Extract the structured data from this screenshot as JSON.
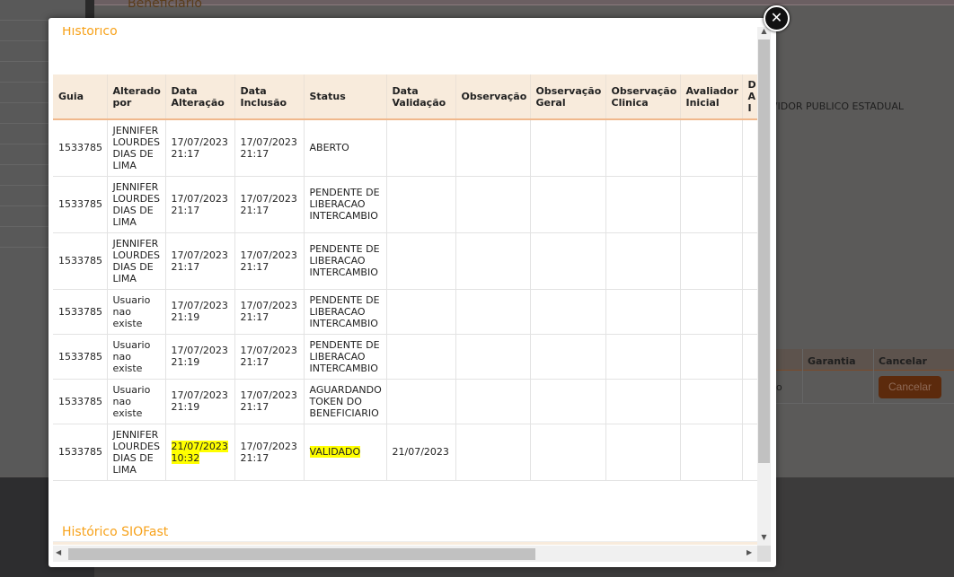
{
  "background": {
    "section_title": "Beneficiario",
    "partial_text": "VIDOR PUBLICO ESTADUAL",
    "table_headers": [
      "Garantia",
      "Cancelar"
    ],
    "partial_cell": "o",
    "cancel_button": "Cancelar"
  },
  "modal": {
    "close_icon": "close-x-icon",
    "title": "Histórico",
    "columns": [
      "Guia",
      "Alterado por",
      "Data Alteração",
      "Data Inclusão",
      "Status",
      "Data Validação",
      "Observação",
      "Observação Geral",
      "Observação Clinica",
      "Avaliador Inicial",
      "D A I"
    ],
    "rows": [
      {
        "guia": "1533785",
        "alterado_por": "JENNIFER LOURDES DIAS DE LIMA",
        "data_alteracao": "17/07/2023 21:17",
        "data_inclusao": "17/07/2023 21:17",
        "status": "ABERTO",
        "data_validacao": ""
      },
      {
        "guia": "1533785",
        "alterado_por": "JENNIFER LOURDES DIAS DE LIMA",
        "data_alteracao": "17/07/2023 21:17",
        "data_inclusao": "17/07/2023 21:17",
        "status": "PENDENTE DE LIBERACAO INTERCAMBIO",
        "data_validacao": ""
      },
      {
        "guia": "1533785",
        "alterado_por": "JENNIFER LOURDES DIAS DE LIMA",
        "data_alteracao": "17/07/2023 21:17",
        "data_inclusao": "17/07/2023 21:17",
        "status": "PENDENTE DE LIBERACAO INTERCAMBIO",
        "data_validacao": ""
      },
      {
        "guia": "1533785",
        "alterado_por": "Usuario nao existe",
        "data_alteracao": "17/07/2023 21:19",
        "data_inclusao": "17/07/2023 21:17",
        "status": "PENDENTE DE LIBERACAO INTERCAMBIO",
        "data_validacao": ""
      },
      {
        "guia": "1533785",
        "alterado_por": "Usuario nao existe",
        "data_alteracao": "17/07/2023 21:19",
        "data_inclusao": "17/07/2023 21:17",
        "status": "PENDENTE DE LIBERACAO INTERCAMBIO",
        "data_validacao": ""
      },
      {
        "guia": "1533785",
        "alterado_por": "Usuario nao existe",
        "data_alteracao": "17/07/2023 21:19",
        "data_inclusao": "17/07/2023 21:17",
        "status": "AGUARDANDO TOKEN DO BENEFICIARIO",
        "data_validacao": ""
      },
      {
        "guia": "1533785",
        "alterado_por": "JENNIFER LOURDES DIAS DE LIMA",
        "data_alteracao": "21/07/2023 10:32",
        "data_inclusao": "17/07/2023 21:17",
        "status": "VALIDADO",
        "data_validacao": "21/07/2023",
        "highlighted": true
      }
    ],
    "section2_title": "Histórico SIOFast",
    "highlight_color": "#ffff00",
    "accent_color": "#f7a21b"
  }
}
